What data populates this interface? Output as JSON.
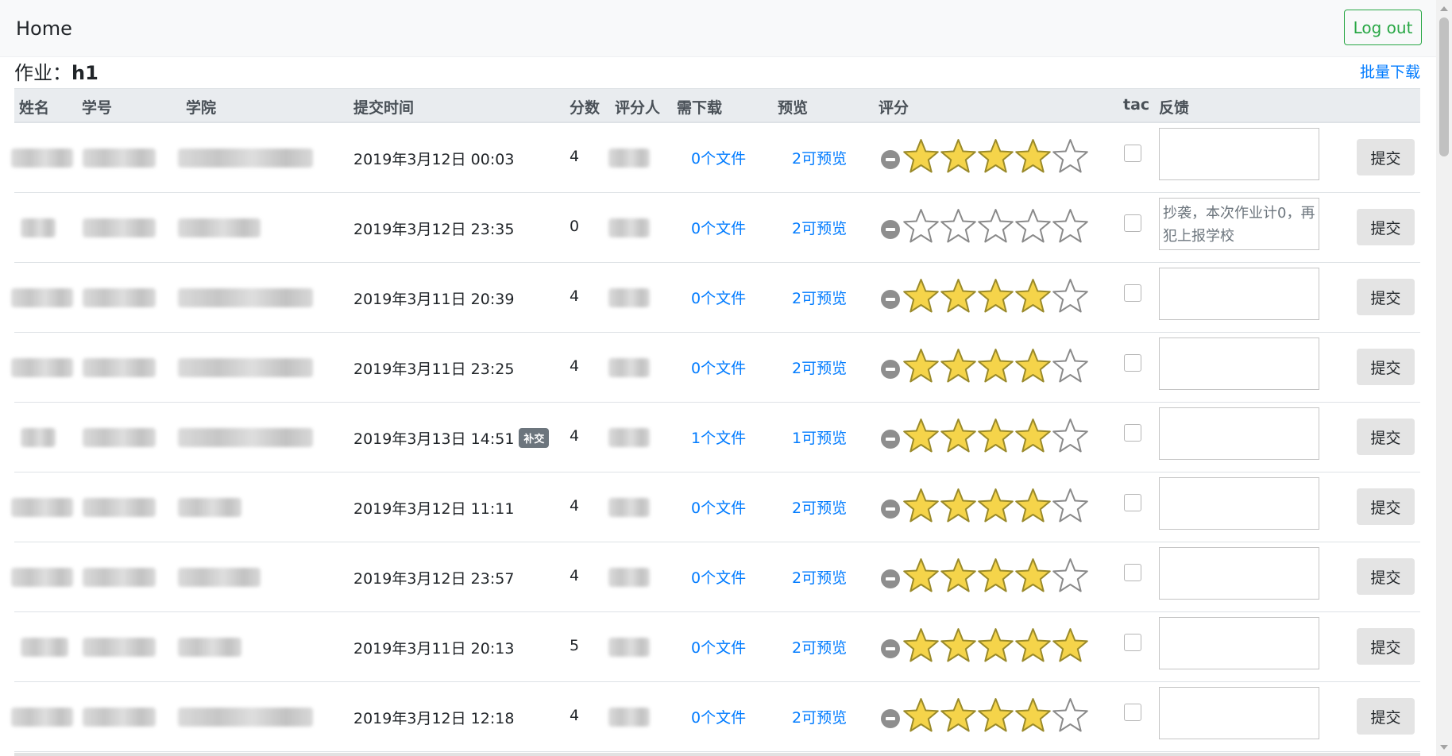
{
  "nav": {
    "brand": "Home",
    "logout_label": "Log out"
  },
  "assignment": {
    "label": "作业：",
    "name": "h1",
    "batch_download": "批量下载"
  },
  "table": {
    "headers": {
      "name": "姓名",
      "student_id": "学号",
      "college": "学院",
      "submit_time": "提交时间",
      "score": "分数",
      "grader": "评分人",
      "need_download": "需下载",
      "preview": "预览",
      "rating": "评分",
      "tac": "tac",
      "feedback": "反馈"
    },
    "submit_label": "提交",
    "rows": [
      {
        "time": "2019年3月12日 00:03",
        "late_badge": "",
        "score": "4",
        "files": "0个文件",
        "preview": "2可预览",
        "stars": 4,
        "feedback": ""
      },
      {
        "time": "2019年3月12日 23:35",
        "late_badge": "",
        "score": "0",
        "files": "0个文件",
        "preview": "2可预览",
        "stars": 0,
        "feedback": "抄袭，本次作业计0，再犯上报学校"
      },
      {
        "time": "2019年3月11日 20:39",
        "late_badge": "",
        "score": "4",
        "files": "0个文件",
        "preview": "2可预览",
        "stars": 4,
        "feedback": ""
      },
      {
        "time": "2019年3月11日 23:25",
        "late_badge": "",
        "score": "4",
        "files": "0个文件",
        "preview": "2可预览",
        "stars": 4,
        "feedback": ""
      },
      {
        "time": "2019年3月13日 14:51",
        "late_badge": "补交",
        "score": "4",
        "files": "1个文件",
        "preview": "1可预览",
        "stars": 4,
        "feedback": ""
      },
      {
        "time": "2019年3月12日 11:11",
        "late_badge": "",
        "score": "4",
        "files": "0个文件",
        "preview": "2可预览",
        "stars": 4,
        "feedback": ""
      },
      {
        "time": "2019年3月12日 23:57",
        "late_badge": "",
        "score": "4",
        "files": "0个文件",
        "preview": "2可预览",
        "stars": 4,
        "feedback": ""
      },
      {
        "time": "2019年3月11日 20:13",
        "late_badge": "",
        "score": "5",
        "files": "0个文件",
        "preview": "2可预览",
        "stars": 5,
        "feedback": ""
      },
      {
        "time": "2019年3月12日 12:18",
        "late_badge": "",
        "score": "4",
        "files": "0个文件",
        "preview": "2可预览",
        "stars": 4,
        "feedback": ""
      }
    ]
  },
  "colors": {
    "primary": "#007bff",
    "success": "#28a745",
    "star_fill": "#f5d44a",
    "star_stroke": "#8a8a8a",
    "badge": "#6c757d",
    "header_bg": "#e9ecef",
    "navbar_bg": "#f8f9fa"
  },
  "icons": {
    "rating_minus": "minus-circle-icon",
    "star": "star-icon",
    "checkbox": "checkbox-icon"
  }
}
